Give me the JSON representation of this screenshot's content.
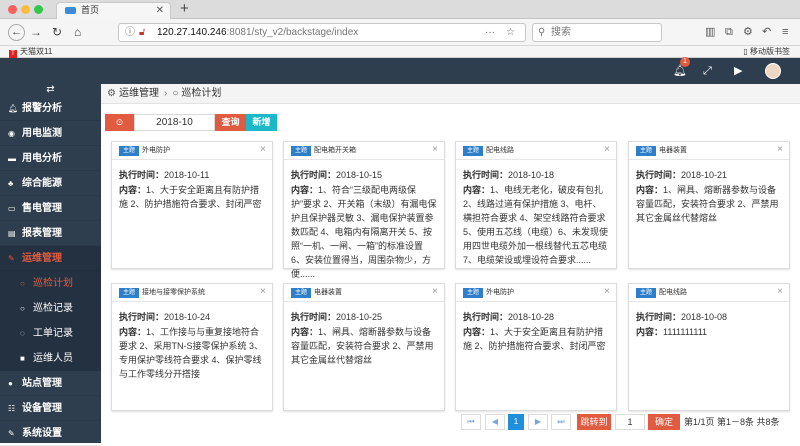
{
  "browser": {
    "tab_title": "首页",
    "url_host": "120.27.140.246",
    "url_path": ":8081/sty_v2/backstage/index",
    "search_placeholder": "搜索",
    "bookmark_left": "天猫双11",
    "bookmark_right": "移动版书签"
  },
  "header": {
    "notification_count": "1"
  },
  "sidebar": {
    "items": [
      {
        "label": "报警分析",
        "icon": "bell"
      },
      {
        "label": "用电监测",
        "icon": "eye"
      },
      {
        "label": "用电分析",
        "icon": "chart"
      },
      {
        "label": "综合能源",
        "icon": "tree"
      },
      {
        "label": "售电管理",
        "icon": "card"
      },
      {
        "label": "报表管理",
        "icon": "doc"
      },
      {
        "label": "运维管理",
        "icon": "wrench"
      }
    ],
    "subitems": [
      {
        "label": "巡检计划",
        "icon": "circle"
      },
      {
        "label": "巡检记录",
        "icon": "circle"
      },
      {
        "label": "工单记录",
        "icon": "comment"
      },
      {
        "label": "运维人员",
        "icon": "square"
      }
    ],
    "items_bottom": [
      {
        "label": "站点管理",
        "icon": "pin"
      },
      {
        "label": "设备管理",
        "icon": "sitemap"
      },
      {
        "label": "系统设置",
        "icon": "wrench"
      }
    ]
  },
  "breadcrumb": {
    "level1": "运维管理",
    "level2": "巡检计划"
  },
  "toolbar": {
    "date_value": "2018-10",
    "query_label": "查询",
    "add_label": "新增"
  },
  "card_labels": {
    "tag": "主题",
    "exec_time_label": "执行时间：",
    "content_label": "内容："
  },
  "cards": [
    {
      "title": "外电防护",
      "time": "2018-10-11",
      "content": "1、大于安全距离且有防护措施 2、防护措施符合要求、封闭严密"
    },
    {
      "title": "配电箱开关箱",
      "time": "2018-10-15",
      "content": "1、符合“三级配电两级保护”要求 2、开关箱（末级）有漏电保护且保护器灵敏 3、漏电保护装置参数匹配 4、电箱内有隔离开关 5、按照“一机、一闸、一箱”的标准设置 6、安装位置得当，周围杂物少，方便......"
    },
    {
      "title": "配电线路",
      "time": "2018-10-18",
      "content": "1、电线无老化，破皮有包扎 2、线路过道有保护措施 3、电杆、横担符合要求 4、架空线路符合要求 5、使用五芯线（电缆）6、未发现使用四世电缆外加一根线替代五芯电缆 7、电缆架设或埋设符合要求......"
    },
    {
      "title": "电器装置",
      "time": "2018-10-21",
      "content": "1、闸具、熔断器参数与设备容量匹配，安装符合要求 2、严禁用其它金属丝代替熔丝"
    },
    {
      "title": "接地与接零保护系统",
      "time": "2018-10-24",
      "content": "1、工作接与与重复接地符合要求 2、采用TN-S接零保护系统 3、专用保护零线符合要求 4、保护零线与工作零线分开搭接"
    },
    {
      "title": "电器装置",
      "time": "2018-10-25",
      "content": "1、闸具、熔断器参数与设备容量匹配，安装符合要求 2、严禁用其它金属丝代替熔丝"
    },
    {
      "title": "外电防护",
      "time": "2018-10-28",
      "content": "1、大于安全距离且有防护措施 2、防护措施符合要求、封闭严密"
    },
    {
      "title": "配电线路",
      "time": "2018-10-08",
      "content": "1111111111"
    }
  ],
  "pagination": {
    "current_page": "1",
    "jump_label": "跳转到",
    "page_input": "1",
    "go_label": "确定",
    "info": "第1/1页 第1－8条 共8条"
  },
  "colors": {
    "sidebar_bg": "#2e3e4e",
    "accent": "#e05b3f",
    "teal": "#1ab8c8",
    "tag_blue": "#2f7ec9"
  }
}
